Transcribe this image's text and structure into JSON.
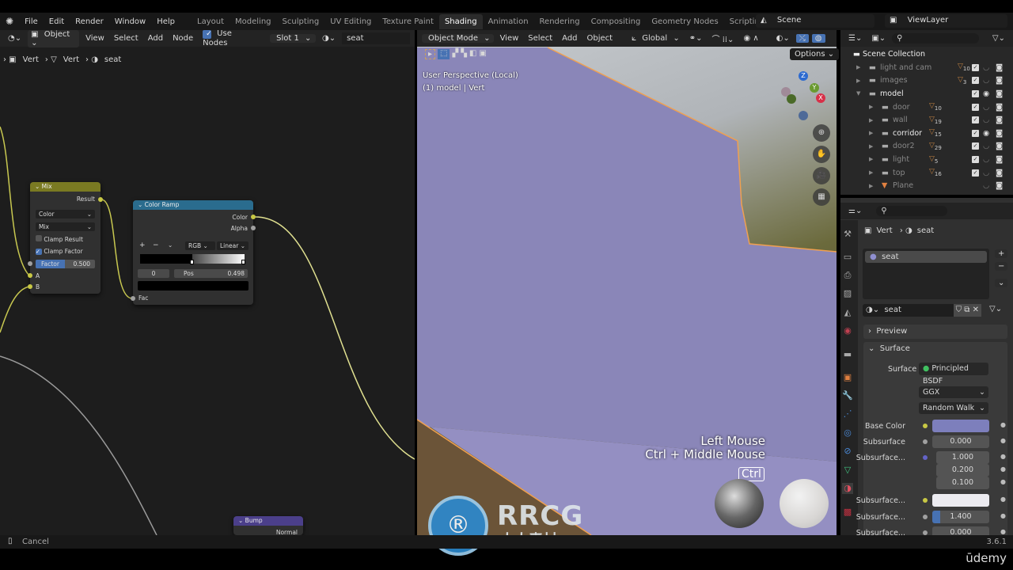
{
  "menu": {
    "items": [
      "File",
      "Edit",
      "Render",
      "Window",
      "Help"
    ],
    "workspaces": [
      "Layout",
      "Modeling",
      "Sculpting",
      "UV Editing",
      "Texture Paint",
      "Shading",
      "Animation",
      "Rendering",
      "Compositing",
      "Geometry Nodes",
      "Scripting"
    ],
    "active_workspace": "Shading",
    "add_tab": "+",
    "scene": "Scene",
    "view_layer": "ViewLayer"
  },
  "node_editor": {
    "header": {
      "object_mode": "Object",
      "menus": [
        "View",
        "Select",
        "Add",
        "Node"
      ],
      "use_nodes_label": "Use Nodes",
      "use_nodes": true,
      "slot": "Slot 1",
      "material": "seat"
    },
    "breadcrumb": [
      "Vert",
      "Vert",
      "seat"
    ],
    "mix_node": {
      "title": "Mix",
      "output": "Result",
      "data_type": "Color",
      "blend": "Mix",
      "clamp_result_label": "Clamp Result",
      "clamp_result": false,
      "clamp_factor_label": "Clamp Factor",
      "clamp_factor": true,
      "factor_label": "Factor",
      "factor": "0.500",
      "inputs": [
        "A",
        "B"
      ],
      "color": "#7a7a22"
    },
    "color_ramp_node": {
      "title": "Color Ramp",
      "outputs": [
        "Color",
        "Alpha"
      ],
      "add": "+",
      "remove": "−",
      "color_mode": "RGB",
      "interpolation": "Linear",
      "index": "0",
      "pos_label": "Pos",
      "pos": "0.498",
      "input": "Fac",
      "color": "#2a6c8e"
    },
    "bump_node": {
      "title": "Bump",
      "output": "Normal",
      "color": "#4b3f8a"
    }
  },
  "viewport": {
    "mode": "Object Mode",
    "menus": [
      "View",
      "Select",
      "Add",
      "Object"
    ],
    "orientation": "Global",
    "options": "Options",
    "info_line1": "User Perspective (Local)",
    "info_line2": "(1) model | Vert",
    "gizmo_axes": [
      "Z",
      "Y",
      "X"
    ],
    "key_hint1": "Left Mouse",
    "key_hint2": "Ctrl + Middle Mouse",
    "key_badge": "Ctrl",
    "mesh_color": "#8a86b8",
    "outline_color": "#f0a050"
  },
  "outliner": {
    "root": "Scene Collection",
    "items": [
      {
        "name": "light and cam",
        "count": "10",
        "indent": 1,
        "expanded": false,
        "eye": false
      },
      {
        "name": "images",
        "count": "3",
        "indent": 1,
        "expanded": false,
        "eye": false
      },
      {
        "name": "model",
        "count": "",
        "indent": 1,
        "expanded": true,
        "eye": true
      },
      {
        "name": "door",
        "count": "10",
        "indent": 2,
        "expanded": false,
        "eye": false
      },
      {
        "name": "wall",
        "count": "19",
        "indent": 2,
        "expanded": false,
        "eye": false
      },
      {
        "name": "corridor",
        "count": "15",
        "indent": 2,
        "expanded": false,
        "eye": true
      },
      {
        "name": "door2",
        "count": "29",
        "indent": 2,
        "expanded": false,
        "eye": false
      },
      {
        "name": "light",
        "count": "5",
        "indent": 2,
        "expanded": false,
        "eye": false
      },
      {
        "name": "top",
        "count": "16",
        "indent": 2,
        "expanded": false,
        "eye": false
      },
      {
        "name": "Plane",
        "count": "",
        "indent": 2,
        "expanded": false,
        "eye": false
      }
    ]
  },
  "properties": {
    "breadcrumb": [
      "Vert",
      "seat"
    ],
    "slot_name": "seat",
    "material_name": "seat",
    "panels": {
      "preview": "Preview",
      "surface": "Surface"
    },
    "surface_label": "Surface",
    "surface_shader": "Principled BSDF",
    "distribution": "GGX",
    "subsurface_method": "Random Walk",
    "rows": [
      {
        "label": "Base Color",
        "value": "",
        "socket": "#c8c844",
        "swatch": "#7d7fbc"
      },
      {
        "label": "Subsurface",
        "value": "0.000",
        "socket": "#a0a0a0"
      },
      {
        "label": "Subsurface...",
        "value": "1.000",
        "socket": "#6363c7"
      },
      {
        "label": "",
        "value": "0.200"
      },
      {
        "label": "",
        "value": "0.100"
      },
      {
        "label": "Subsurface...",
        "value": "",
        "socket": "#c8c844",
        "swatch": "#ecebf0"
      },
      {
        "label": "Subsurface...",
        "value": "1.400",
        "socket": "#a0a0a0"
      },
      {
        "label": "Subsurface...",
        "value": "0.000",
        "socket": "#a0a0a0"
      }
    ]
  },
  "status": {
    "left": "Cancel",
    "version": "3.6.1"
  },
  "watermark": {
    "text": "RRCG",
    "subtitle": "人人素材"
  },
  "brand": "ūdemy"
}
